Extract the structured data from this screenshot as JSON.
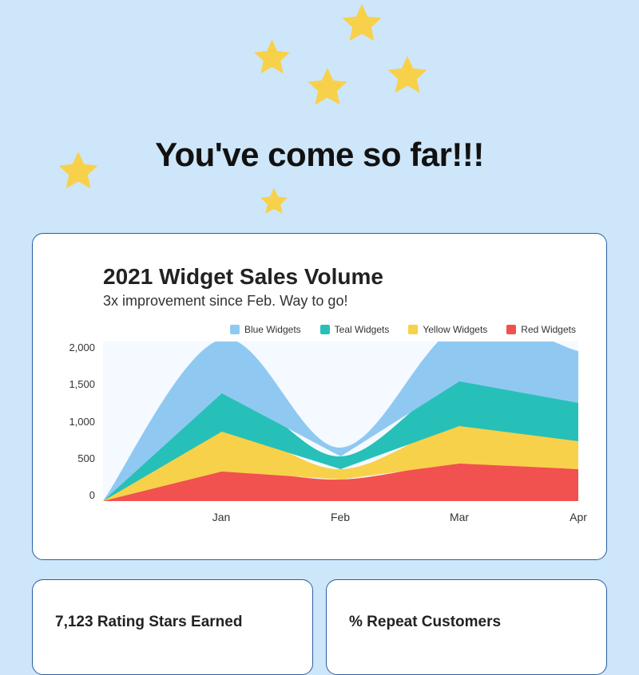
{
  "page_title": "You've come so far!!!",
  "chart_card": {
    "title": "2021 Widget Sales Volume",
    "subtitle": "3x improvement since Feb. Way to go!"
  },
  "legend": [
    {
      "name": "Blue Widgets",
      "color": "#8fc9f2"
    },
    {
      "name": "Teal Widgets",
      "color": "#27c0b8"
    },
    {
      "name": "Yellow Widgets",
      "color": "#f8d14a"
    },
    {
      "name": "Red Widgets",
      "color": "#f1514f"
    }
  ],
  "y_ticks": [
    "2,000",
    "1,500",
    "1,000",
    "500",
    "0"
  ],
  "x_ticks": [
    "Jan",
    "Feb",
    "Mar",
    "Apr"
  ],
  "stats": {
    "left_title": "7,123 Rating Stars Earned",
    "right_title": "% Repeat Customers"
  },
  "chart_data": {
    "type": "area",
    "stacked": true,
    "title": "2021 Widget Sales Volume",
    "xlabel": "",
    "ylabel": "",
    "ylim": [
      0,
      2000
    ],
    "categories": [
      "Jan",
      "Feb",
      "Mar",
      "Apr"
    ],
    "series": [
      {
        "name": "Red Widgets",
        "color": "#f1514f",
        "values": [
          370,
          270,
          470,
          400
        ]
      },
      {
        "name": "Yellow Widgets",
        "color": "#f8d14a",
        "values": [
          500,
          130,
          470,
          350
        ]
      },
      {
        "name": "Teal Widgets",
        "color": "#27c0b8",
        "values": [
          480,
          160,
          560,
          480
        ]
      },
      {
        "name": "Blue Widgets",
        "color": "#8fc9f2",
        "values": [
          680,
          110,
          700,
          650
        ]
      }
    ],
    "legend_position": "top-right",
    "grid": false
  }
}
